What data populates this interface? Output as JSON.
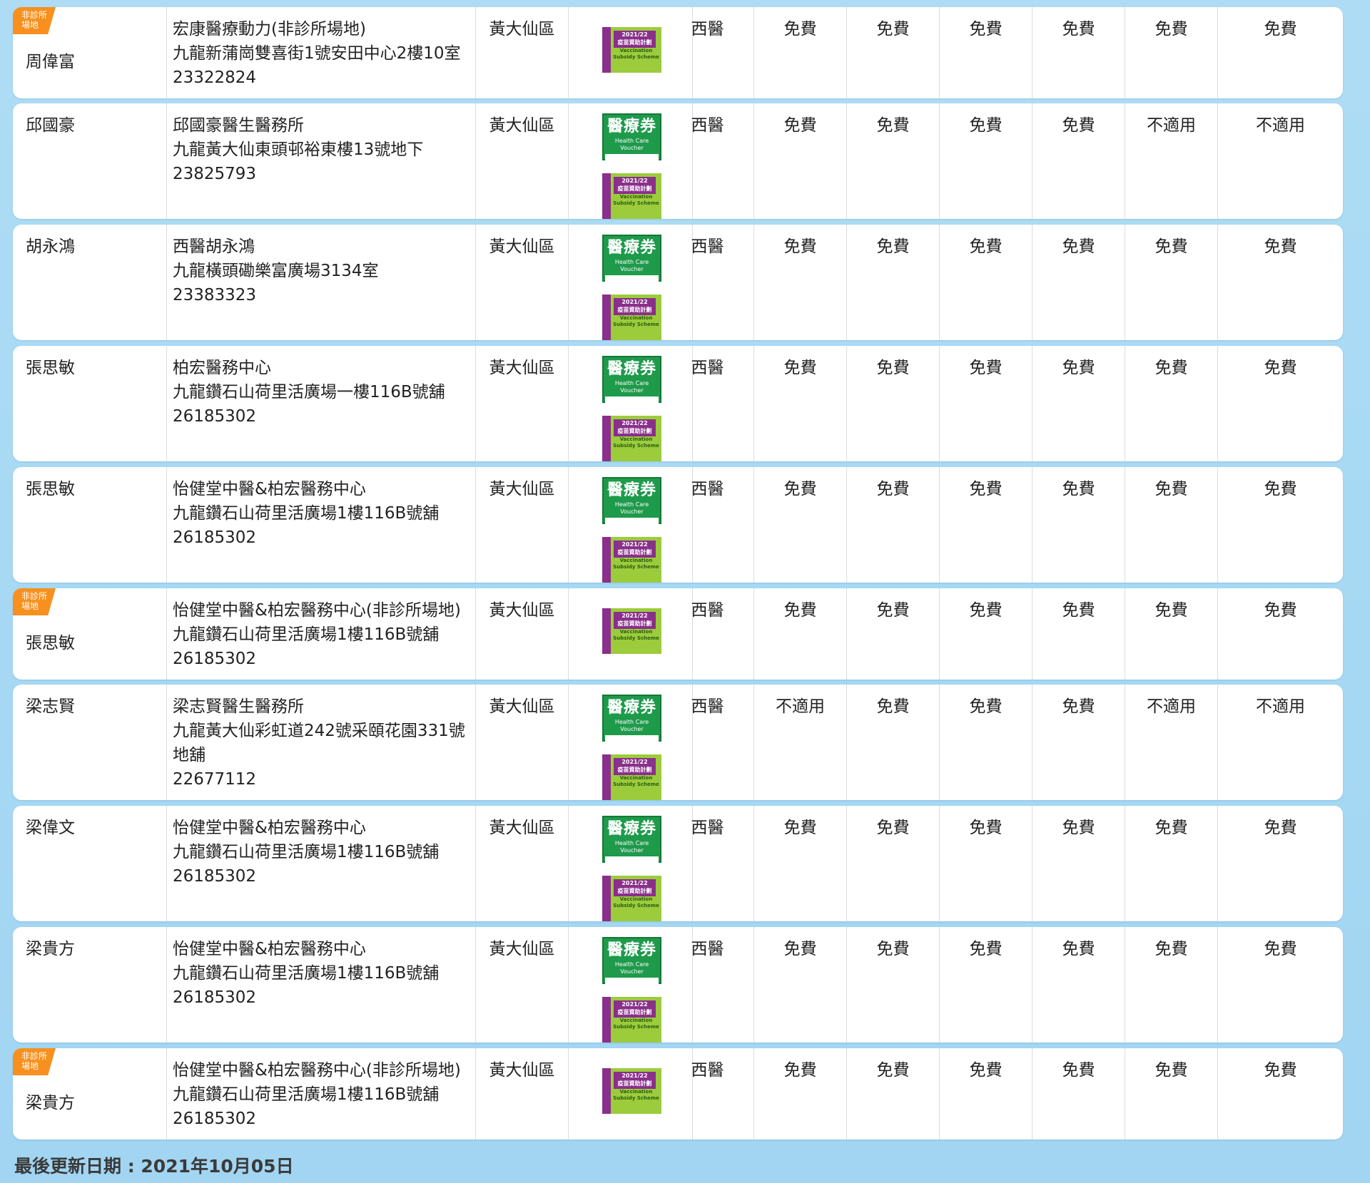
{
  "tag_line1": "非診所",
  "tag_line2": "場地",
  "vouchers": {
    "hcv_title": "醫療券",
    "hcv_sub": "Health Care Voucher",
    "vss_year": "2021/22",
    "vss_title": "疫苗資助計劃",
    "vss_sub1": "Vaccination",
    "vss_sub2": "Subsidy Scheme"
  },
  "rows": [
    {
      "name": "周偉富",
      "tag": true,
      "clinic": "宏康醫療動力(非診所場地)",
      "address": [
        "九龍新蒲崗雙喜街1號安田中心2樓10室"
      ],
      "phone": "23322824",
      "district": "黃大仙區",
      "hcv": false,
      "vss": true,
      "type": "西醫",
      "fees": [
        "免費",
        "免費",
        "免費",
        "免費",
        "免費",
        "免費"
      ]
    },
    {
      "name": "邱國豪",
      "tag": false,
      "clinic": "邱國豪醫生醫務所",
      "address": [
        "九龍黃大仙東頭邨裕東樓13號地下"
      ],
      "phone": "23825793",
      "district": "黃大仙區",
      "hcv": true,
      "vss": true,
      "type": "西醫",
      "fees": [
        "免費",
        "免費",
        "免費",
        "免費",
        "不適用",
        "不適用"
      ]
    },
    {
      "name": "胡永鴻",
      "tag": false,
      "clinic": "西醫胡永鴻",
      "address": [
        "九龍橫頭磡樂富廣場3134室"
      ],
      "phone": "23383323",
      "district": "黃大仙區",
      "hcv": true,
      "vss": true,
      "type": "西醫",
      "fees": [
        "免費",
        "免費",
        "免費",
        "免費",
        "免費",
        "免費"
      ]
    },
    {
      "name": "張思敏",
      "tag": false,
      "clinic": "柏宏醫務中心",
      "address": [
        "九龍鑽石山荷里活廣場一樓116B號舖"
      ],
      "phone": "26185302",
      "district": "黃大仙區",
      "hcv": true,
      "vss": true,
      "type": "西醫",
      "fees": [
        "免費",
        "免費",
        "免費",
        "免費",
        "免費",
        "免費"
      ]
    },
    {
      "name": "張思敏",
      "tag": false,
      "clinic": "怡健堂中醫&柏宏醫務中心",
      "address": [
        "九龍鑽石山荷里活廣場1樓116B號舖"
      ],
      "phone": "26185302",
      "district": "黃大仙區",
      "hcv": true,
      "vss": true,
      "type": "西醫",
      "fees": [
        "免費",
        "免費",
        "免費",
        "免費",
        "免費",
        "免費"
      ]
    },
    {
      "name": "張思敏",
      "tag": true,
      "clinic": "怡健堂中醫&柏宏醫務中心(非診所場地)",
      "address": [
        "九龍鑽石山荷里活廣場1樓116B號舖"
      ],
      "phone": "26185302",
      "district": "黃大仙區",
      "hcv": false,
      "vss": true,
      "type": "西醫",
      "fees": [
        "免費",
        "免費",
        "免費",
        "免費",
        "免費",
        "免費"
      ]
    },
    {
      "name": "梁志賢",
      "tag": false,
      "clinic": "梁志賢醫生醫務所",
      "address": [
        "九龍黃大仙彩虹道242號采頤花園331號",
        "地舖"
      ],
      "phone": "22677112",
      "district": "黃大仙區",
      "hcv": true,
      "vss": true,
      "type": "西醫",
      "fees": [
        "不適用",
        "免費",
        "免費",
        "免費",
        "不適用",
        "不適用"
      ]
    },
    {
      "name": "梁偉文",
      "tag": false,
      "clinic": "怡健堂中醫&柏宏醫務中心",
      "address": [
        "九龍鑽石山荷里活廣場1樓116B號舖"
      ],
      "phone": "26185302",
      "district": "黃大仙區",
      "hcv": true,
      "vss": true,
      "type": "西醫",
      "fees": [
        "免費",
        "免費",
        "免費",
        "免費",
        "免費",
        "免費"
      ]
    },
    {
      "name": "梁貴方",
      "tag": false,
      "clinic": "怡健堂中醫&柏宏醫務中心",
      "address": [
        "九龍鑽石山荷里活廣場1樓116B號舖"
      ],
      "phone": "26185302",
      "district": "黃大仙區",
      "hcv": true,
      "vss": true,
      "type": "西醫",
      "fees": [
        "免費",
        "免費",
        "免費",
        "免費",
        "免費",
        "免費"
      ]
    },
    {
      "name": "梁貴方",
      "tag": true,
      "clinic": "怡健堂中醫&柏宏醫務中心(非診所場地)",
      "address": [
        "九龍鑽石山荷里活廣場1樓116B號舖"
      ],
      "phone": "26185302",
      "district": "黃大仙區",
      "hcv": false,
      "vss": true,
      "type": "西醫",
      "fees": [
        "免費",
        "免費",
        "免費",
        "免費",
        "免費",
        "免費"
      ]
    }
  ],
  "footer": {
    "last_updated": "最後更新日期 : 2021年10月05日"
  }
}
